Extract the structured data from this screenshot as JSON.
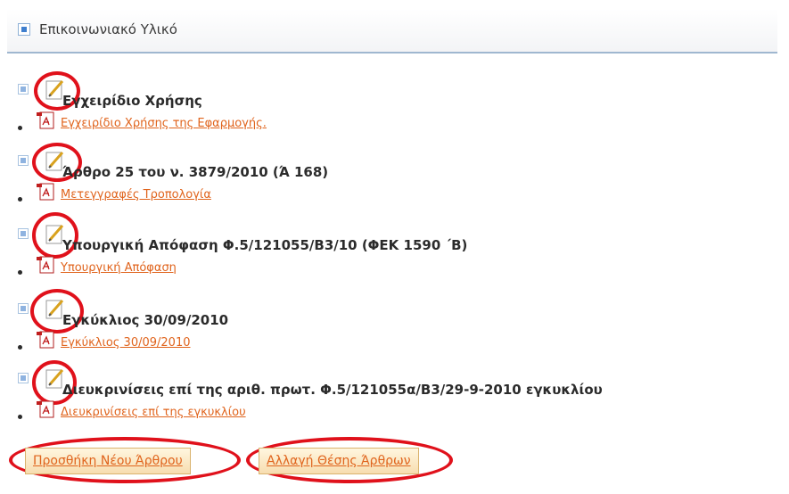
{
  "panel": {
    "title": "Επικοινωνιακό Υλικό",
    "header_icon": "square-bullet-icon"
  },
  "articles": [
    {
      "title": "Εγχειρίδιο Χρήσης",
      "link": "Εγχειρίδιο Χρήσης της Εφαρμογής."
    },
    {
      "title": "Άρθρο 25 του ν. 3879/2010 (Ά 168)",
      "link": "Μετεγγραφές Τροπολογία"
    },
    {
      "title": "Υπουργική Απόφαση Φ.5/121055/Β3/10 (ΦΕΚ 1590 ΄Β)",
      "link": "Υπουργική Απόφαση"
    },
    {
      "title": "Εγκύκλιος 30/09/2010",
      "link": "Εγκύκλιος 30/09/2010"
    },
    {
      "title": "Διευκρινίσεις επί της αριθ. πρωτ. Φ.5/121055α/Β3/29-9-2010 εγκυκλίου",
      "link": "Διευκρινίσεις επί της εγκυκλίου"
    }
  ],
  "buttons": {
    "add_article": "Προσθήκη Νέου Άρθρου",
    "reorder_articles": "Αλλαγή Θέσης Άρθρων"
  },
  "icons": {
    "edit": "pencil-edit-icon",
    "pdf": "pdf-file-icon",
    "collapse": "square-bullet-icon"
  },
  "colors": {
    "link": "#e0641d",
    "highlight_circle": "#e0111b",
    "header_underline": "#9fb7d0",
    "icon_blue": "#3f7fce"
  }
}
